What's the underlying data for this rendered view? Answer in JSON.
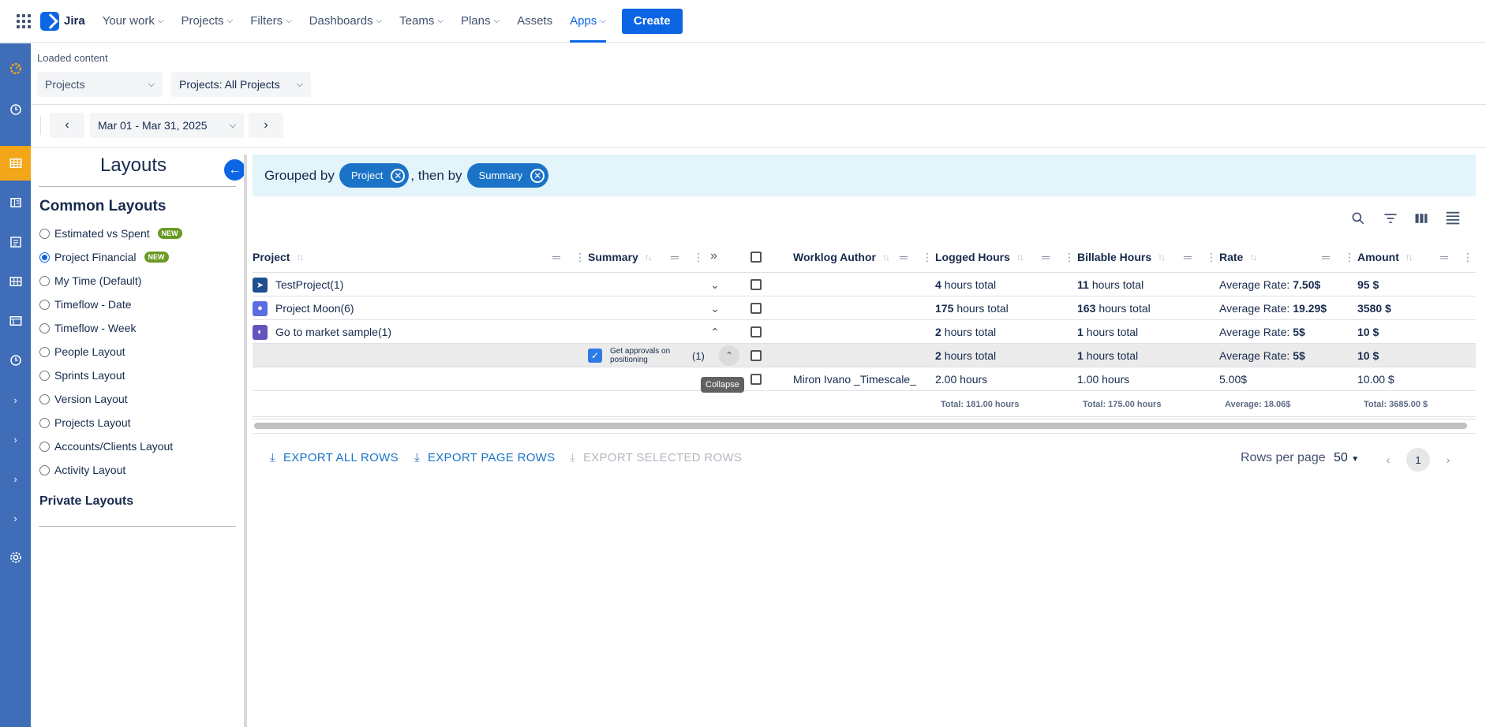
{
  "topnav": {
    "brand": "Jira",
    "items": [
      {
        "label": "Your work",
        "chevron": true
      },
      {
        "label": "Projects",
        "chevron": true
      },
      {
        "label": "Filters",
        "chevron": true
      },
      {
        "label": "Dashboards",
        "chevron": true
      },
      {
        "label": "Teams",
        "chevron": true
      },
      {
        "label": "Plans",
        "chevron": true
      },
      {
        "label": "Assets",
        "chevron": false
      },
      {
        "label": "Apps",
        "chevron": true,
        "active": true
      }
    ],
    "create_label": "Create"
  },
  "rail": {
    "items": [
      "timeflow-logo-icon",
      "clock-icon",
      "table-icon",
      "board-icon",
      "document-icon",
      "grid-icon",
      "layout-icon",
      "clock-icon",
      "chevron-right-icon",
      "chevron-right-icon",
      "chevron-right-icon",
      "chevron-right-icon",
      "gear-icon"
    ],
    "active_index": 2,
    "accent": "#f2a618",
    "background": "#3f6db7"
  },
  "header": {
    "loaded_label": "Loaded content",
    "source_select": "Projects",
    "scope_select": "Projects: All Projects",
    "date_range": "Mar 01 - Mar 31, 2025"
  },
  "layouts": {
    "title": "Layouts",
    "common_heading": "Common Layouts",
    "items": [
      {
        "label": "Estimated vs Spent",
        "badge": "NEW",
        "selected": false
      },
      {
        "label": "Project Financial",
        "badge": "NEW",
        "selected": true
      },
      {
        "label": "My Time (Default)",
        "selected": false
      },
      {
        "label": "Timeflow - Date",
        "selected": false
      },
      {
        "label": "Timeflow - Week",
        "selected": false
      },
      {
        "label": "People Layout",
        "selected": false
      },
      {
        "label": "Sprints Layout",
        "selected": false
      },
      {
        "label": "Version Layout",
        "selected": false
      },
      {
        "label": "Projects Layout",
        "selected": false
      },
      {
        "label": "Accounts/Clients Layout",
        "selected": false
      },
      {
        "label": "Activity Layout",
        "selected": false
      }
    ],
    "private_heading": "Private Layouts"
  },
  "grouping": {
    "prefix": "Grouped by",
    "first": "Project",
    "connector": ", then by",
    "second": "Summary"
  },
  "columns": {
    "project": "Project",
    "summary": "Summary",
    "worklog_author": "Worklog Author",
    "logged_hours": "Logged Hours",
    "billable_hours": "Billable Hours",
    "rate": "Rate",
    "amount": "Amount"
  },
  "rows": [
    {
      "project": "TestProject(1)",
      "icon_color": "#1d4f91",
      "logged_num": "4",
      "logged_suffix": "hours total",
      "billable_num": "11",
      "billable_suffix": "hours total",
      "rate_prefix": "Average Rate:",
      "rate_val": "7.50$",
      "amount": "95 $",
      "expanded": false
    },
    {
      "project": "Project Moon(6)",
      "icon_color": "#5b6ee1",
      "logged_num": "175",
      "logged_suffix": "hours total",
      "billable_num": "163",
      "billable_suffix": "hours total",
      "rate_prefix": "Average Rate:",
      "rate_val": "19.29$",
      "amount": "3580 $",
      "expanded": false
    },
    {
      "project": "Go to market sample(1)",
      "icon_color": "#6554c0",
      "logged_num": "2",
      "logged_suffix": "hours total",
      "billable_num": "1",
      "billable_suffix": "hours total",
      "rate_prefix": "Average Rate:",
      "rate_val": "5$",
      "amount": "10 $",
      "expanded": true
    }
  ],
  "subrow": {
    "summary_line1": "Get approvals on",
    "summary_line2": "positioning",
    "count": "(1)",
    "logged_num": "2",
    "logged_suffix": "hours total",
    "billable_num": "1",
    "billable_suffix": "hours total",
    "rate_prefix": "Average Rate:",
    "rate_val": "5$",
    "amount": "10 $",
    "tooltip": "Collapse"
  },
  "leafrow": {
    "author": "Miron Ivano _Timescale_",
    "logged": "2.00 hours",
    "billable": "1.00 hours",
    "rate": "5.00$",
    "amount": "10.00 $"
  },
  "totals": {
    "logged": "Total: 181.00 hours",
    "billable": "Total: 175.00 hours",
    "rate": "Average: 18.06$",
    "amount": "Total: 3685.00 $"
  },
  "footer": {
    "export_all": "EXPORT ALL ROWS",
    "export_page": "EXPORT PAGE ROWS",
    "export_selected": "EXPORT SELECTED ROWS",
    "rows_per_page_label": "Rows per page",
    "rows_per_page_value": "50",
    "current_page": "1"
  }
}
